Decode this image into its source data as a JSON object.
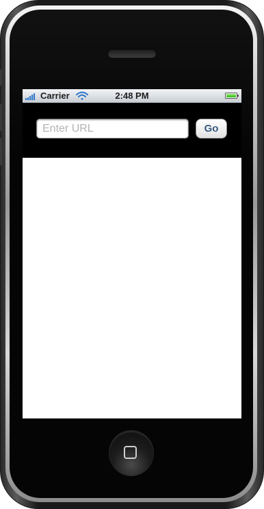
{
  "status_bar": {
    "carrier": "Carrier",
    "time": "2:48 PM",
    "icons": [
      "signal-bars-icon",
      "wifi-icon",
      "battery-icon"
    ],
    "battery_level": 1.0
  },
  "toolbar": {
    "url_value": "",
    "url_placeholder": "Enter URL",
    "go_label": "Go"
  },
  "colors": {
    "signal_blue": "#2a74c9",
    "wifi_blue": "#2a74c9",
    "battery_green": "#2fb51e",
    "go_text": "#3b5a82",
    "toolbar_bg": "#000000",
    "content_bg": "#ffffff"
  },
  "hardware": {
    "icons": [
      "speaker-grille-icon",
      "home-button-icon"
    ]
  }
}
